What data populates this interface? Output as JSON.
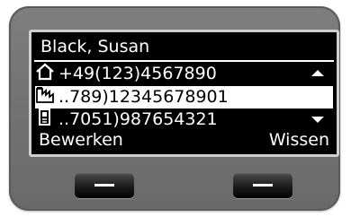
{
  "screen": {
    "title": "Black, Susan",
    "entries": [
      {
        "icon": "home-icon",
        "number": "+49(123)4567890",
        "selected": false
      },
      {
        "icon": "office-icon",
        "number": "..789)12345678901",
        "selected": true
      },
      {
        "icon": "mobile-icon",
        "number": "..7051)987654321",
        "selected": false
      }
    ],
    "softkeys": {
      "left": "Bewerken",
      "right": "Wissen"
    }
  },
  "colors": {
    "screen_bg": "#000000",
    "screen_text": "#ffffff",
    "highlight_bg": "#ffffff",
    "highlight_text": "#000000",
    "device_body": "#747474"
  }
}
